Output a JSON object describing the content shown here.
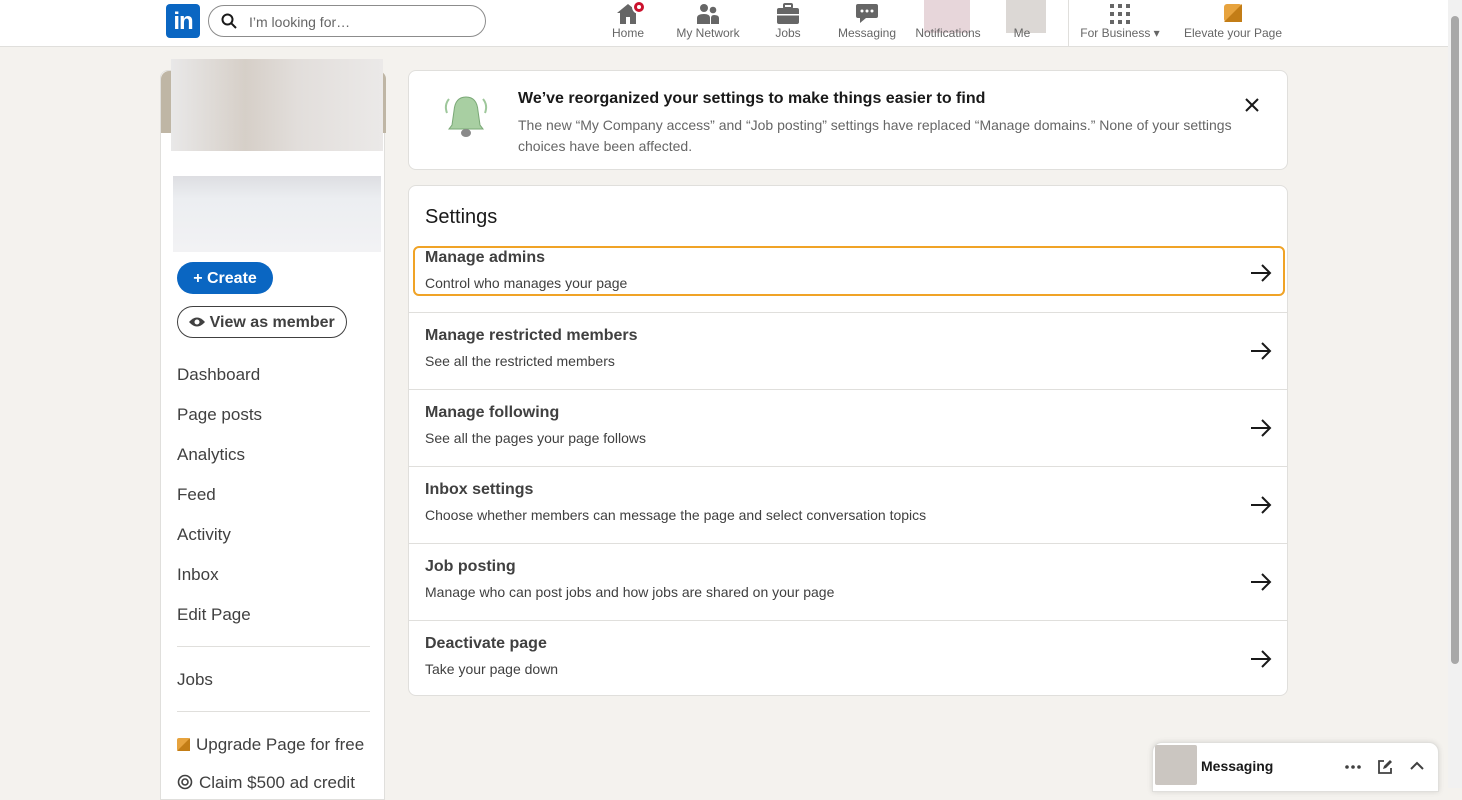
{
  "topnav": {
    "search_placeholder": "I’m looking for…",
    "items": [
      {
        "label": "Home",
        "icon": "home-icon"
      },
      {
        "label": "My Network",
        "icon": "people-icon"
      },
      {
        "label": "Jobs",
        "icon": "briefcase-icon"
      },
      {
        "label": "Messaging",
        "icon": "chat-icon"
      },
      {
        "label": "Notifications",
        "icon": "bell-icon"
      },
      {
        "label": "Me",
        "icon": "avatar"
      },
      {
        "label": "For Business",
        "icon": "grid-icon"
      },
      {
        "label": "Elevate your Page",
        "icon": "premium-icon"
      }
    ]
  },
  "sidebar": {
    "create_label": "Create",
    "view_member_label": "View as member",
    "menu": [
      "Dashboard",
      "Page posts",
      "Analytics",
      "Feed",
      "Activity",
      "Inbox",
      "Edit Page"
    ],
    "jobs_label": "Jobs",
    "upgrade_label": "Upgrade Page for free",
    "claim_label": "Claim $500 ad credit"
  },
  "notice": {
    "title": "We’ve reorganized your settings to make things easier to find",
    "body": "The new “My Company access” and “Job posting” settings have replaced “Manage domains.” None of your settings choices have been affected."
  },
  "settings": {
    "title": "Settings",
    "rows": [
      {
        "title": "Manage admins",
        "subtitle": "Control who manages your page"
      },
      {
        "title": "Manage restricted members",
        "subtitle": "See all the restricted members"
      },
      {
        "title": "Manage following",
        "subtitle": "See all the pages your page follows"
      },
      {
        "title": "Inbox settings",
        "subtitle": "Choose whether members can message the page and select conversation topics"
      },
      {
        "title": "Job posting",
        "subtitle": "Manage who can post jobs and how jobs are shared on your page"
      },
      {
        "title": "Deactivate page",
        "subtitle": "Take your page down"
      }
    ]
  },
  "messaging": {
    "label": "Messaging"
  },
  "colors": {
    "brand": "#0a66c2",
    "highlight": "#f0a326",
    "background": "#f4f2ee",
    "badge": "#cb112d"
  }
}
